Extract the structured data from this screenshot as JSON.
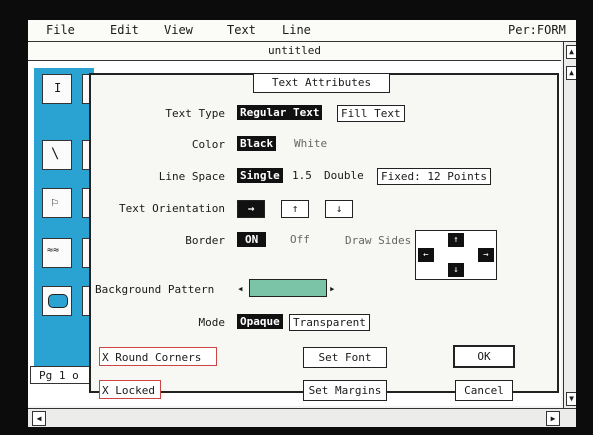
{
  "app": {
    "menus": [
      "File",
      "Edit",
      "View",
      "Text",
      "Line"
    ],
    "mode": "Per:FORM",
    "document_title": "untitled",
    "page_indicator": "Pg 1 o"
  },
  "dialog": {
    "title": "Text Attributes",
    "text_type": {
      "label": "Text Type",
      "options": [
        "Regular Text",
        "Fill Text"
      ],
      "selected": "Regular Text"
    },
    "color": {
      "label": "Color",
      "options": [
        "Black",
        "White"
      ],
      "selected": "Black"
    },
    "line_space": {
      "label": "Line Space",
      "options": [
        "Single",
        "1.5",
        "Double",
        "Fixed: 12 Points"
      ],
      "selected": "Single"
    },
    "text_orientation": {
      "label": "Text Orientation",
      "options": [
        "→",
        "↑",
        "↓"
      ],
      "selected": "→"
    },
    "border": {
      "label": "Border",
      "options": [
        "ON",
        "Off"
      ],
      "selected": "ON",
      "draw_sides_label": "Draw Sides"
    },
    "background_pattern": {
      "label": "Background Pattern",
      "swatch_color": "#7cc4a8"
    },
    "mode": {
      "label": "Mode",
      "options": [
        "Opaque",
        "Transparent"
      ],
      "selected": "Opaque"
    },
    "checkboxes": {
      "round_corners": "X Round Corners",
      "locked": "X Locked"
    },
    "buttons": {
      "set_font": "Set Font",
      "set_margins": "Set Margins",
      "ok": "OK",
      "cancel": "Cancel"
    }
  },
  "colors": {
    "toolbox": "#2aa3d2",
    "selected": "#111111",
    "pattern": "#7cc4a8"
  }
}
